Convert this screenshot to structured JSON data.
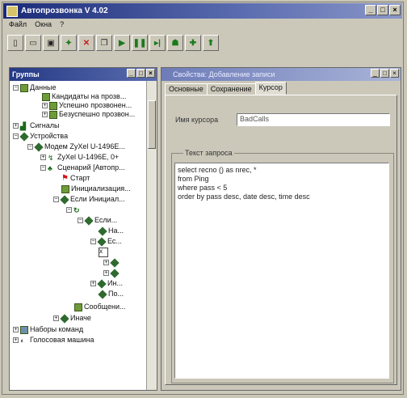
{
  "window": {
    "title": "Автопрозвонка V 4.02"
  },
  "menu": {
    "items": [
      "Файл",
      "Окна",
      "?"
    ]
  },
  "toolbar": {
    "icons": [
      "new-icon",
      "open-icon",
      "save-icon",
      "add-icon",
      "delete-icon",
      "copy-icon",
      "play-icon",
      "pause-icon",
      "step-icon",
      "user-icon",
      "settings-icon",
      "help-icon"
    ]
  },
  "left_panel": {
    "title": "Группы",
    "tree": [
      {
        "label": "Данные",
        "depth": 1
      },
      {
        "label": "Кандидаты на прозв...",
        "depth": 2
      },
      {
        "label": "Успешно прозвонен...",
        "depth": 2
      },
      {
        "label": "Безуспешно прозвон...",
        "depth": 2
      },
      {
        "label": "Сигналы",
        "depth": 1
      },
      {
        "label": "Устройства",
        "depth": 1
      },
      {
        "label": "Модем ZyXel U-1496E...",
        "depth": 2
      },
      {
        "label": "ZyXel U-1496E, 0+",
        "depth": 3
      },
      {
        "label": "Сценарий [Автопр...",
        "depth": 3
      },
      {
        "label": "Старт",
        "depth": 4
      },
      {
        "label": "Инициализация...",
        "depth": 4
      },
      {
        "label": "Если Инициал...",
        "depth": 4
      },
      {
        "label": "",
        "depth": 5
      },
      {
        "label": "Если...",
        "depth": 6
      },
      {
        "label": "На...",
        "depth": 7
      },
      {
        "label": "Ес...",
        "depth": 7
      },
      {
        "label": "",
        "depth": 7
      },
      {
        "label": "",
        "depth": 8
      },
      {
        "label": "",
        "depth": 8
      },
      {
        "label": "Ин...",
        "depth": 7
      },
      {
        "label": "По...",
        "depth": 7
      },
      {
        "label": "Сообщени...",
        "depth": 5
      },
      {
        "label": "Иначе",
        "depth": 4
      },
      {
        "label": "Наборы команд",
        "depth": 1
      },
      {
        "label": "Голосовая машина",
        "depth": 1
      }
    ]
  },
  "right_panel": {
    "title": "Свойства: Добавление записи",
    "tabs": [
      "Основные",
      "Сохранение",
      "Курсор"
    ],
    "active_tab": "Курсор",
    "cursor_name_label": "Имя курсора",
    "cursor_name_value": "BadCalls",
    "query_group_title": "Текст запроса",
    "query_text": "select recno () as nrec, *\nfrom Ping\nwhere pass < 5\norder by pass desc, date desc, time desc"
  }
}
